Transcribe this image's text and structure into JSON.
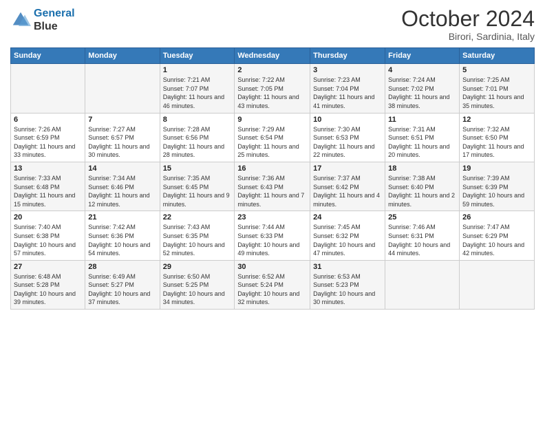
{
  "header": {
    "logo_line1": "General",
    "logo_line2": "Blue",
    "month": "October 2024",
    "location": "Birori, Sardinia, Italy"
  },
  "weekdays": [
    "Sunday",
    "Monday",
    "Tuesday",
    "Wednesday",
    "Thursday",
    "Friday",
    "Saturday"
  ],
  "weeks": [
    [
      {
        "day": "",
        "info": ""
      },
      {
        "day": "",
        "info": ""
      },
      {
        "day": "1",
        "info": "Sunrise: 7:21 AM\nSunset: 7:07 PM\nDaylight: 11 hours and 46 minutes."
      },
      {
        "day": "2",
        "info": "Sunrise: 7:22 AM\nSunset: 7:05 PM\nDaylight: 11 hours and 43 minutes."
      },
      {
        "day": "3",
        "info": "Sunrise: 7:23 AM\nSunset: 7:04 PM\nDaylight: 11 hours and 41 minutes."
      },
      {
        "day": "4",
        "info": "Sunrise: 7:24 AM\nSunset: 7:02 PM\nDaylight: 11 hours and 38 minutes."
      },
      {
        "day": "5",
        "info": "Sunrise: 7:25 AM\nSunset: 7:01 PM\nDaylight: 11 hours and 35 minutes."
      }
    ],
    [
      {
        "day": "6",
        "info": "Sunrise: 7:26 AM\nSunset: 6:59 PM\nDaylight: 11 hours and 33 minutes."
      },
      {
        "day": "7",
        "info": "Sunrise: 7:27 AM\nSunset: 6:57 PM\nDaylight: 11 hours and 30 minutes."
      },
      {
        "day": "8",
        "info": "Sunrise: 7:28 AM\nSunset: 6:56 PM\nDaylight: 11 hours and 28 minutes."
      },
      {
        "day": "9",
        "info": "Sunrise: 7:29 AM\nSunset: 6:54 PM\nDaylight: 11 hours and 25 minutes."
      },
      {
        "day": "10",
        "info": "Sunrise: 7:30 AM\nSunset: 6:53 PM\nDaylight: 11 hours and 22 minutes."
      },
      {
        "day": "11",
        "info": "Sunrise: 7:31 AM\nSunset: 6:51 PM\nDaylight: 11 hours and 20 minutes."
      },
      {
        "day": "12",
        "info": "Sunrise: 7:32 AM\nSunset: 6:50 PM\nDaylight: 11 hours and 17 minutes."
      }
    ],
    [
      {
        "day": "13",
        "info": "Sunrise: 7:33 AM\nSunset: 6:48 PM\nDaylight: 11 hours and 15 minutes."
      },
      {
        "day": "14",
        "info": "Sunrise: 7:34 AM\nSunset: 6:46 PM\nDaylight: 11 hours and 12 minutes."
      },
      {
        "day": "15",
        "info": "Sunrise: 7:35 AM\nSunset: 6:45 PM\nDaylight: 11 hours and 9 minutes."
      },
      {
        "day": "16",
        "info": "Sunrise: 7:36 AM\nSunset: 6:43 PM\nDaylight: 11 hours and 7 minutes."
      },
      {
        "day": "17",
        "info": "Sunrise: 7:37 AM\nSunset: 6:42 PM\nDaylight: 11 hours and 4 minutes."
      },
      {
        "day": "18",
        "info": "Sunrise: 7:38 AM\nSunset: 6:40 PM\nDaylight: 11 hours and 2 minutes."
      },
      {
        "day": "19",
        "info": "Sunrise: 7:39 AM\nSunset: 6:39 PM\nDaylight: 10 hours and 59 minutes."
      }
    ],
    [
      {
        "day": "20",
        "info": "Sunrise: 7:40 AM\nSunset: 6:38 PM\nDaylight: 10 hours and 57 minutes."
      },
      {
        "day": "21",
        "info": "Sunrise: 7:42 AM\nSunset: 6:36 PM\nDaylight: 10 hours and 54 minutes."
      },
      {
        "day": "22",
        "info": "Sunrise: 7:43 AM\nSunset: 6:35 PM\nDaylight: 10 hours and 52 minutes."
      },
      {
        "day": "23",
        "info": "Sunrise: 7:44 AM\nSunset: 6:33 PM\nDaylight: 10 hours and 49 minutes."
      },
      {
        "day": "24",
        "info": "Sunrise: 7:45 AM\nSunset: 6:32 PM\nDaylight: 10 hours and 47 minutes."
      },
      {
        "day": "25",
        "info": "Sunrise: 7:46 AM\nSunset: 6:31 PM\nDaylight: 10 hours and 44 minutes."
      },
      {
        "day": "26",
        "info": "Sunrise: 7:47 AM\nSunset: 6:29 PM\nDaylight: 10 hours and 42 minutes."
      }
    ],
    [
      {
        "day": "27",
        "info": "Sunrise: 6:48 AM\nSunset: 5:28 PM\nDaylight: 10 hours and 39 minutes."
      },
      {
        "day": "28",
        "info": "Sunrise: 6:49 AM\nSunset: 5:27 PM\nDaylight: 10 hours and 37 minutes."
      },
      {
        "day": "29",
        "info": "Sunrise: 6:50 AM\nSunset: 5:25 PM\nDaylight: 10 hours and 34 minutes."
      },
      {
        "day": "30",
        "info": "Sunrise: 6:52 AM\nSunset: 5:24 PM\nDaylight: 10 hours and 32 minutes."
      },
      {
        "day": "31",
        "info": "Sunrise: 6:53 AM\nSunset: 5:23 PM\nDaylight: 10 hours and 30 minutes."
      },
      {
        "day": "",
        "info": ""
      },
      {
        "day": "",
        "info": ""
      }
    ]
  ]
}
